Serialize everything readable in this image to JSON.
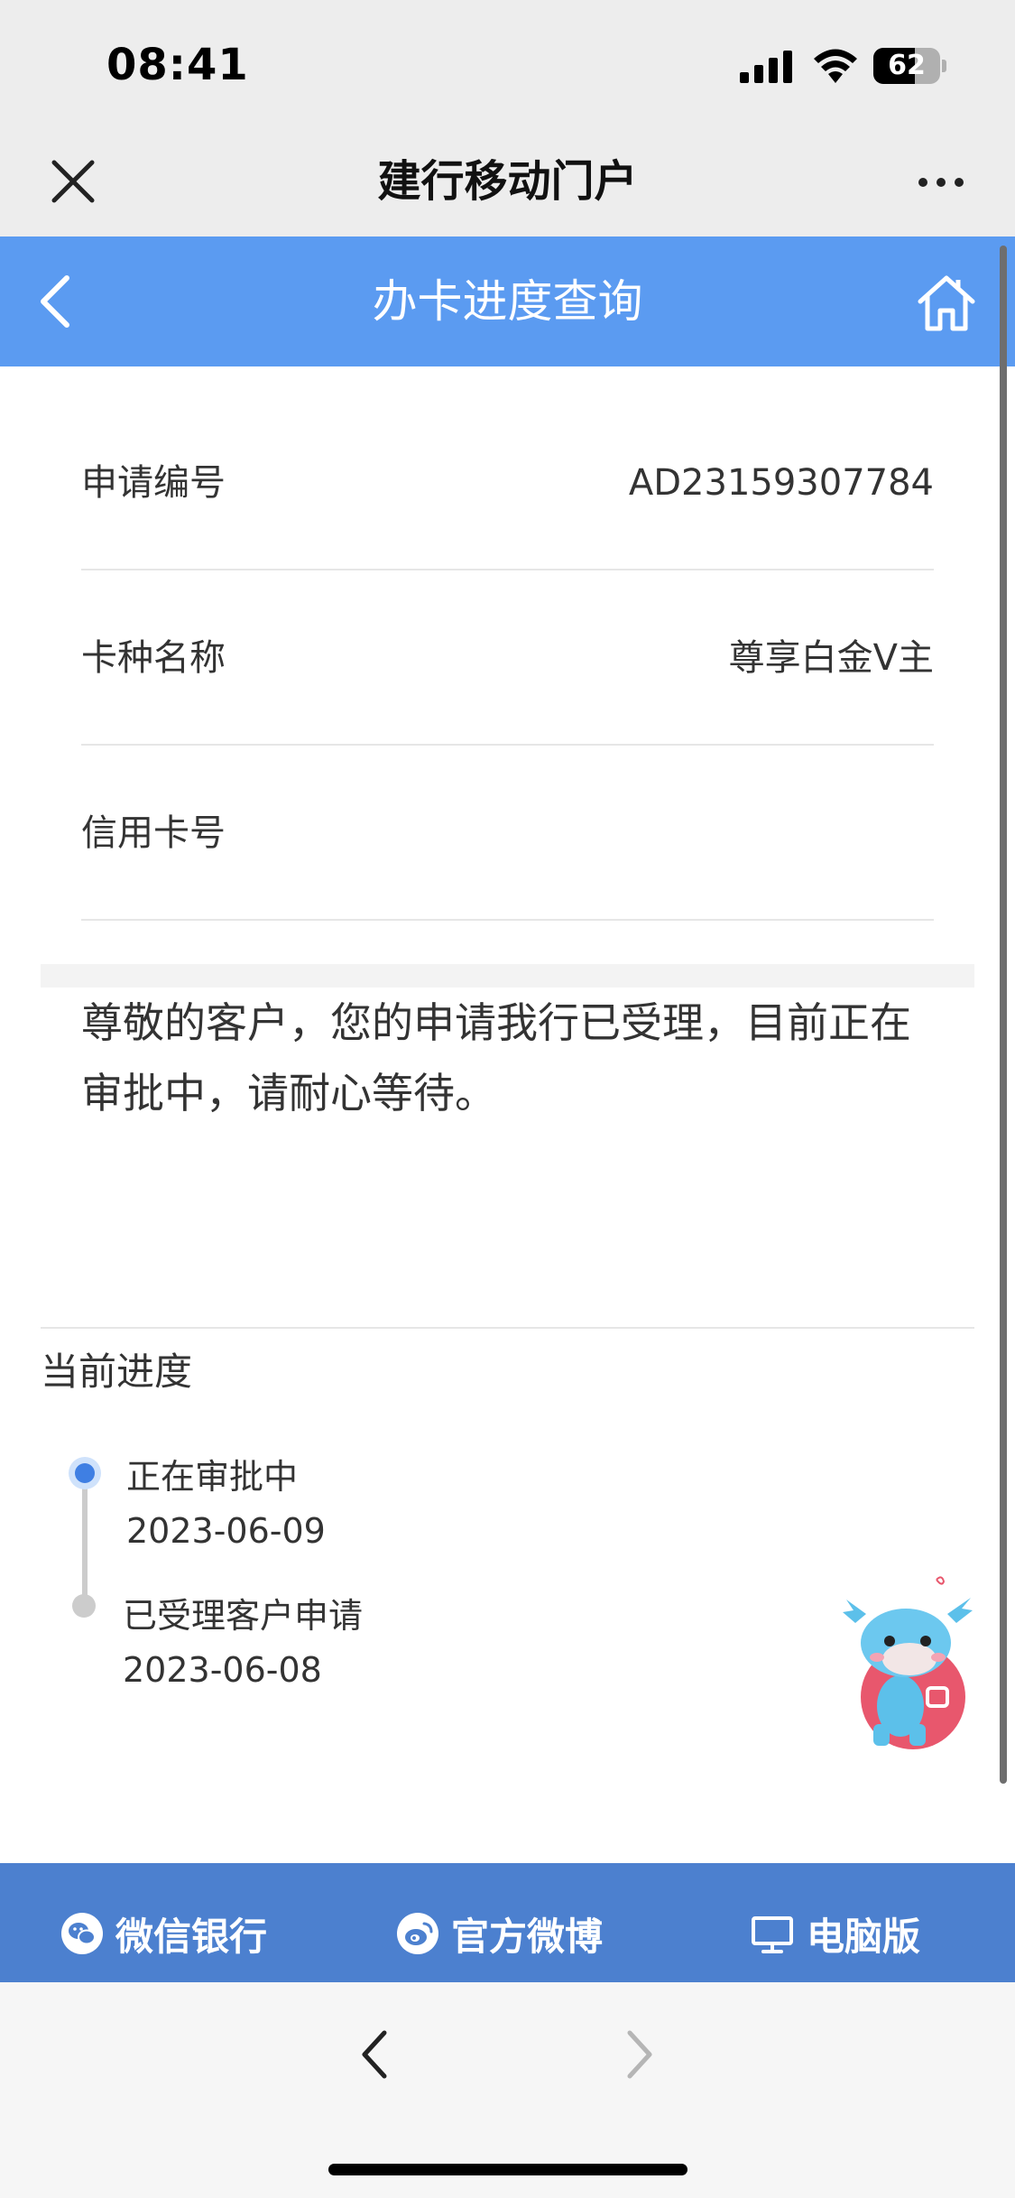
{
  "status_bar": {
    "time": "08:41",
    "battery_level": "62"
  },
  "wx_nav": {
    "title": "建行移动门户"
  },
  "header": {
    "title": "办卡进度查询",
    "background_color": "#5b9bf1"
  },
  "info": [
    {
      "label": "申请编号",
      "value": "AD23159307784"
    },
    {
      "label": "卡种名称",
      "value": "尊享白金V主"
    },
    {
      "label": "信用卡号",
      "value": ""
    }
  ],
  "notice": "尊敬的客户，您的申请我行已受理，目前正在审批中，请耐心等待。",
  "progress": {
    "heading": "当前进度",
    "steps": [
      {
        "status": "正在审批中",
        "date": "2023-06-09"
      },
      {
        "status": "已受理客户申请",
        "date": "2023-06-08"
      }
    ]
  },
  "bottom_links": [
    {
      "label": "微信银行",
      "icon": "wechat-icon"
    },
    {
      "label": "官方微博",
      "icon": "weibo-icon"
    },
    {
      "label": "电脑版",
      "icon": "desktop-icon"
    }
  ],
  "colors": {
    "accent": "#5b9bf1",
    "bottom_bar": "#4c80cf",
    "timeline_active": "#3f7fe3"
  }
}
